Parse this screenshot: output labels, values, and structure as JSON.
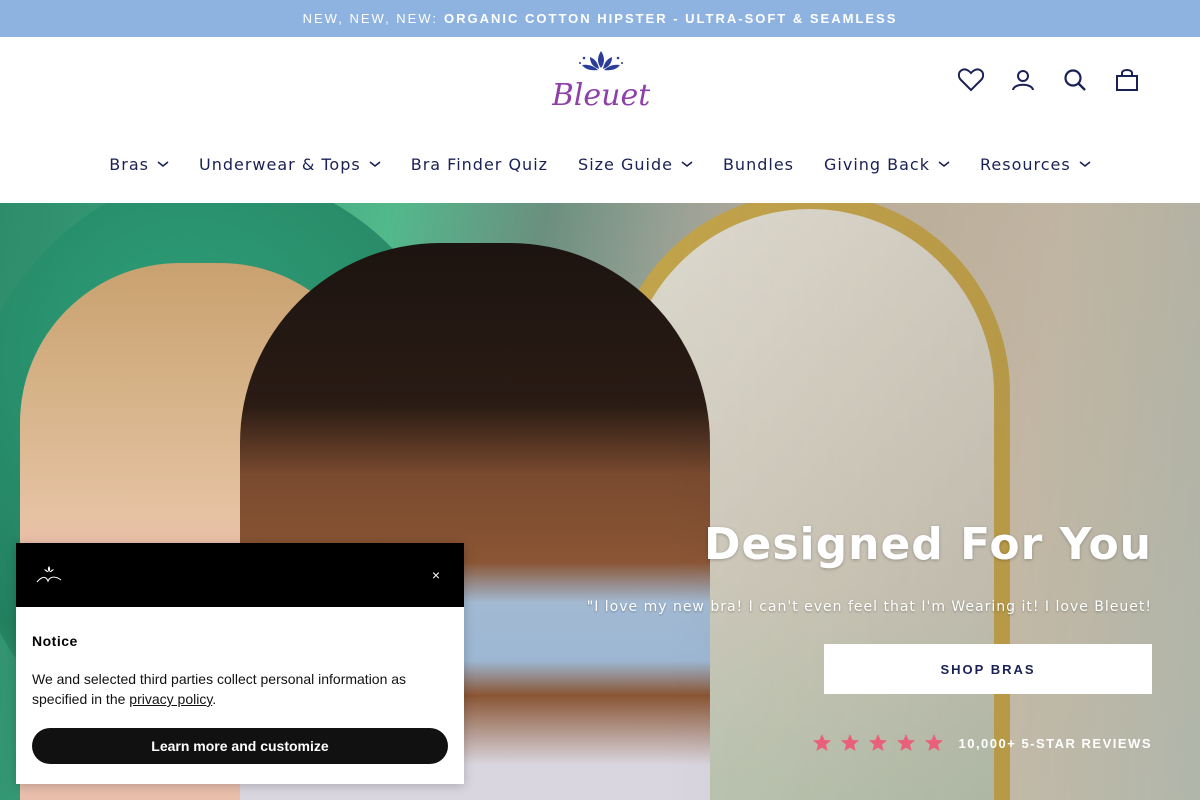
{
  "announcement": {
    "lead": "NEW, NEW, NEW:",
    "text": "ORGANIC COTTON HIPSTER - ULTRA-SOFT & SEAMLESS"
  },
  "brand": {
    "logo_text": "Bleuet",
    "logo_color": "#8e3fa8",
    "flower_color": "#2a3d9a"
  },
  "header_icons": [
    "heart-icon",
    "account-icon",
    "search-icon",
    "cart-icon"
  ],
  "nav": {
    "items": [
      {
        "label": "Bras",
        "has_dropdown": true
      },
      {
        "label": "Underwear & Tops",
        "has_dropdown": true
      },
      {
        "label": "Bra Finder Quiz",
        "has_dropdown": false
      },
      {
        "label": "Size Guide",
        "has_dropdown": true
      },
      {
        "label": "Bundles",
        "has_dropdown": false
      },
      {
        "label": "Giving Back",
        "has_dropdown": true
      },
      {
        "label": "Resources",
        "has_dropdown": true
      }
    ]
  },
  "hero": {
    "title": "Designed For You",
    "quote": "\"I love my new bra! I can't even feel that I'm Wearing it! I love Bleuet!",
    "button_label": "SHOP BRAS",
    "star_count": 5,
    "star_color": "#e8607a",
    "reviews_text": "10,000+ 5-STAR REVIEWS"
  },
  "consent": {
    "title": "Notice",
    "body_before": "We and selected third parties collect personal information as specified in the ",
    "link_text": "privacy policy",
    "body_after": ".",
    "button_label": "Learn more and customize",
    "close_glyph": "×"
  },
  "colors": {
    "announcement_bg": "#8fb3e1",
    "nav_text": "#1a2155",
    "button_text": "#1a2155"
  }
}
